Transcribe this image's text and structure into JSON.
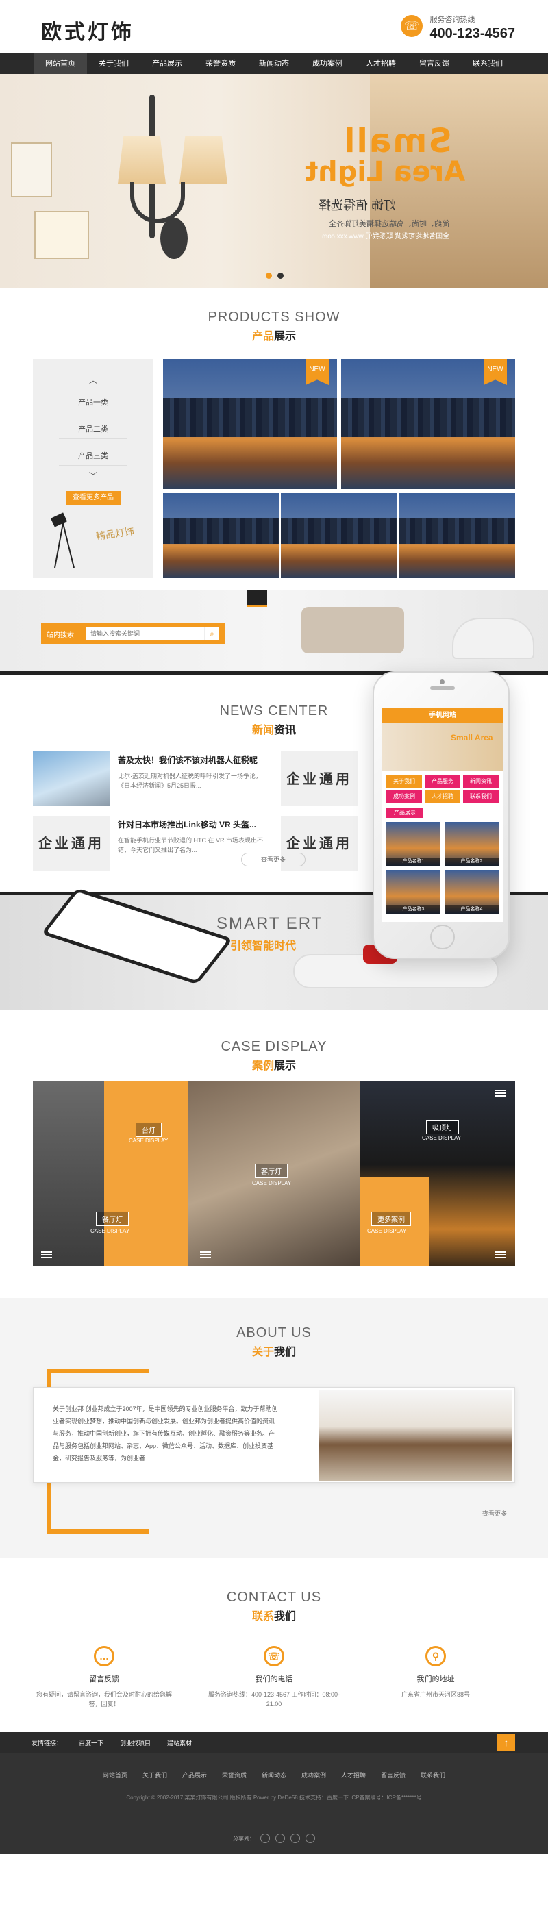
{
  "header": {
    "logo": "欧式灯饰",
    "hotline_label": "服务咨询热线",
    "hotline": "400-123-4567"
  },
  "nav": [
    "网站首页",
    "关于我们",
    "产品展示",
    "荣誉资质",
    "新闻动态",
    "成功案例",
    "人才招聘",
    "留言反馈",
    "联系我们"
  ],
  "banner": {
    "big1": "Small",
    "big2": "Area Light",
    "cn": "灯饰 值得选择",
    "sub": "简约、时尚、高端选择精美灯饰齐全",
    "note": "全国各地均可发货 联系我们 www.xxx.com"
  },
  "products": {
    "en": "PRODUCTS SHOW",
    "cn_hl": "产品",
    "cn_rest": "展示",
    "up_arrow": "︿",
    "categories": [
      "产品一类",
      "产品二类",
      "产品三类"
    ],
    "down_arrow": "﹀",
    "more": "查看更多产品",
    "script": "精品灯饰",
    "new_badge": "NEW"
  },
  "search": {
    "label": "站内搜索",
    "placeholder": "请输入搜索关键词",
    "icon": "search-icon"
  },
  "news": {
    "en": "NEWS CENTER",
    "cn_hl": "新闻",
    "cn_rest": "资讯",
    "items": [
      {
        "title": "苦及太快！我们该不该对机器人征税呢",
        "desc": "比尔·盖茨近期对机器人征税的呼吁引发了一场争论，《日本经济新闻》5月25日报..."
      },
      {
        "title": "企业通用",
        "desc": ""
      },
      {
        "title": "针对日本市场推出Link移动 VR 头盔...",
        "desc": "在智能手机行业节节败退的 HTC 在 VR 市场表现出不错，今天它们又推出了名为..."
      },
      {
        "title": "企业通用",
        "desc": ""
      }
    ],
    "img_text": "企业通用",
    "more": "查看更多"
  },
  "phone": {
    "title": "手机网站",
    "banner": "Small Area",
    "buttons": [
      "关于我们",
      "产品服务",
      "新闻资讯",
      "成功案例",
      "人才招聘",
      "联系我们"
    ],
    "sub": "产品展示",
    "items": [
      "产品名称1",
      "产品名称2",
      "产品名称3",
      "产品名称4"
    ]
  },
  "smart": {
    "en": "SMART ERT",
    "cn": "引领智能时代"
  },
  "case": {
    "en": "CASE DISPLAY",
    "cn_hl": "案例",
    "cn_rest": "展示",
    "tiles": [
      {
        "label": "台灯",
        "sub": "CASE DISPLAY"
      },
      {
        "label": "客厅灯",
        "sub": "CASE DISPLAY"
      },
      {
        "label": "吸顶灯",
        "sub": "CASE DISPLAY"
      },
      {
        "label": "餐厅灯",
        "sub": "CASE DISPLAY"
      },
      {
        "label": "更多案例",
        "sub": "CASE DISPLAY"
      }
    ]
  },
  "about": {
    "en": "ABOUT US",
    "cn_hl": "关于",
    "cn_rest": "我们",
    "text": "关于创业邦 创业邦成立于2007年，是中国领先的专业创业服务平台，致力于帮助创业者实现创业梦想，推动中国创新与创业发展。创业邦为创业者提供高价值的资讯与服务，推动中国创新创业，旗下拥有传媒互动、创业孵化、融资服务等业务。产品与服务包括创业邦网站、杂志、App、微信公众号、活动、数据库、创业投资基金，研究报告及服务等，为创业者...",
    "more": "查看更多"
  },
  "contact": {
    "en": "CONTACT US",
    "cn_hl": "联系",
    "cn_rest": "我们",
    "cols": [
      {
        "icon": "message-icon",
        "title": "留言反馈",
        "desc": "您有疑问，请留言咨询，我们会及时耐心的给您解答，回复！"
      },
      {
        "icon": "phone-icon",
        "title": "我们的电话",
        "desc": "服务咨询热线：400-123-4567 工作时间：08:00-21:00"
      },
      {
        "icon": "location-icon",
        "title": "我们的地址",
        "desc": "广东省广州市天河区88号"
      }
    ]
  },
  "links": {
    "label": "友情链接：",
    "items": [
      "百度一下",
      "创业找项目",
      "建站素材"
    ],
    "top": "↑"
  },
  "footer": {
    "nav": [
      "网站首页",
      "关于我们",
      "产品展示",
      "荣誉资质",
      "新闻动态",
      "成功案例",
      "人才招聘",
      "留言反馈",
      "联系我们"
    ],
    "copy": "Copyright © 2002-2017 某某灯饰有限公司 版权所有 Power by DeDe58   技术支持：百度一下   ICP备案编号：ICP备*******号",
    "share_label": "分享到："
  }
}
